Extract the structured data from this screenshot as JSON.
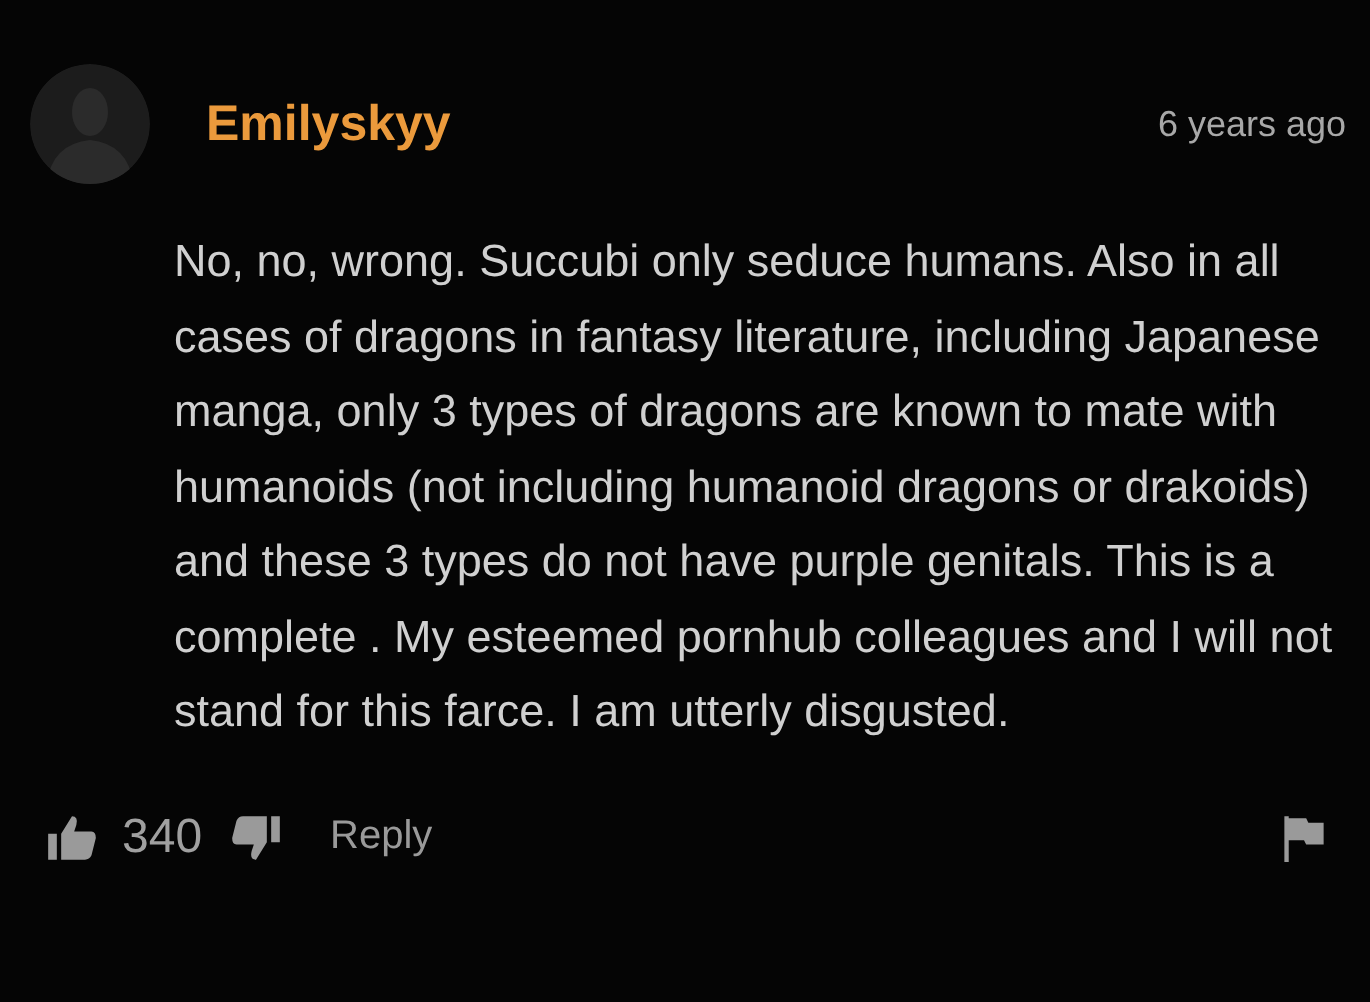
{
  "comment": {
    "author": "Emilyskyy",
    "time": "6 years ago",
    "text": "No, no, wrong. Succubi only seduce humans. Also in all cases of dragons in fantasy literature, including Japanese manga, only 3 types of dragons are known to mate with humanoids (not including humanoid dragons or drakoids) and these 3 types do not have purple genitals. This is a complete . My esteemed pornhub colleagues and I will not stand for this farce. I am utterly disgusted.",
    "likes": "340",
    "reply": "Reply"
  }
}
